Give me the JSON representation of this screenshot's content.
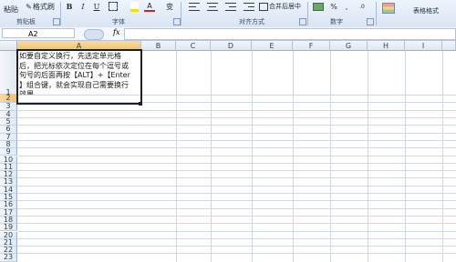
{
  "ribbon": {
    "clipboard": {
      "paste_label": "粘贴",
      "format_painter": "格式刷",
      "group_label": "剪贴板"
    },
    "font": {
      "bold": "B",
      "italic": "I",
      "underline": "U",
      "font_color": "A",
      "wen": "变",
      "group_label": "字体"
    },
    "alignment": {
      "merge_center": "合并后居中",
      "group_label": "对齐方式"
    },
    "number": {
      "percent": "%",
      "comma": ",",
      "group_label": "数字"
    },
    "styles": {
      "table_format": "表格格式"
    }
  },
  "formula_bar": {
    "name_box": "A2",
    "fx": "fx",
    "content": ""
  },
  "columns": [
    "A",
    "B",
    "C",
    "D",
    "E",
    "F",
    "G",
    "H",
    "I"
  ],
  "rows": [
    "1",
    "2",
    "3",
    "4",
    "5",
    "6",
    "7",
    "8",
    "9",
    "10",
    "11",
    "12",
    "13",
    "14",
    "15",
    "16",
    "17",
    "18",
    "19",
    "20",
    "21",
    "22",
    "23"
  ],
  "cells": {
    "A1": "如要自定义换行，先选定单元格\n后，把光标依次定位在每个逗号或\n句号的后面再按【ALT】+【Enter\n】组合键，就会实现自己需要换行\n效果。"
  }
}
